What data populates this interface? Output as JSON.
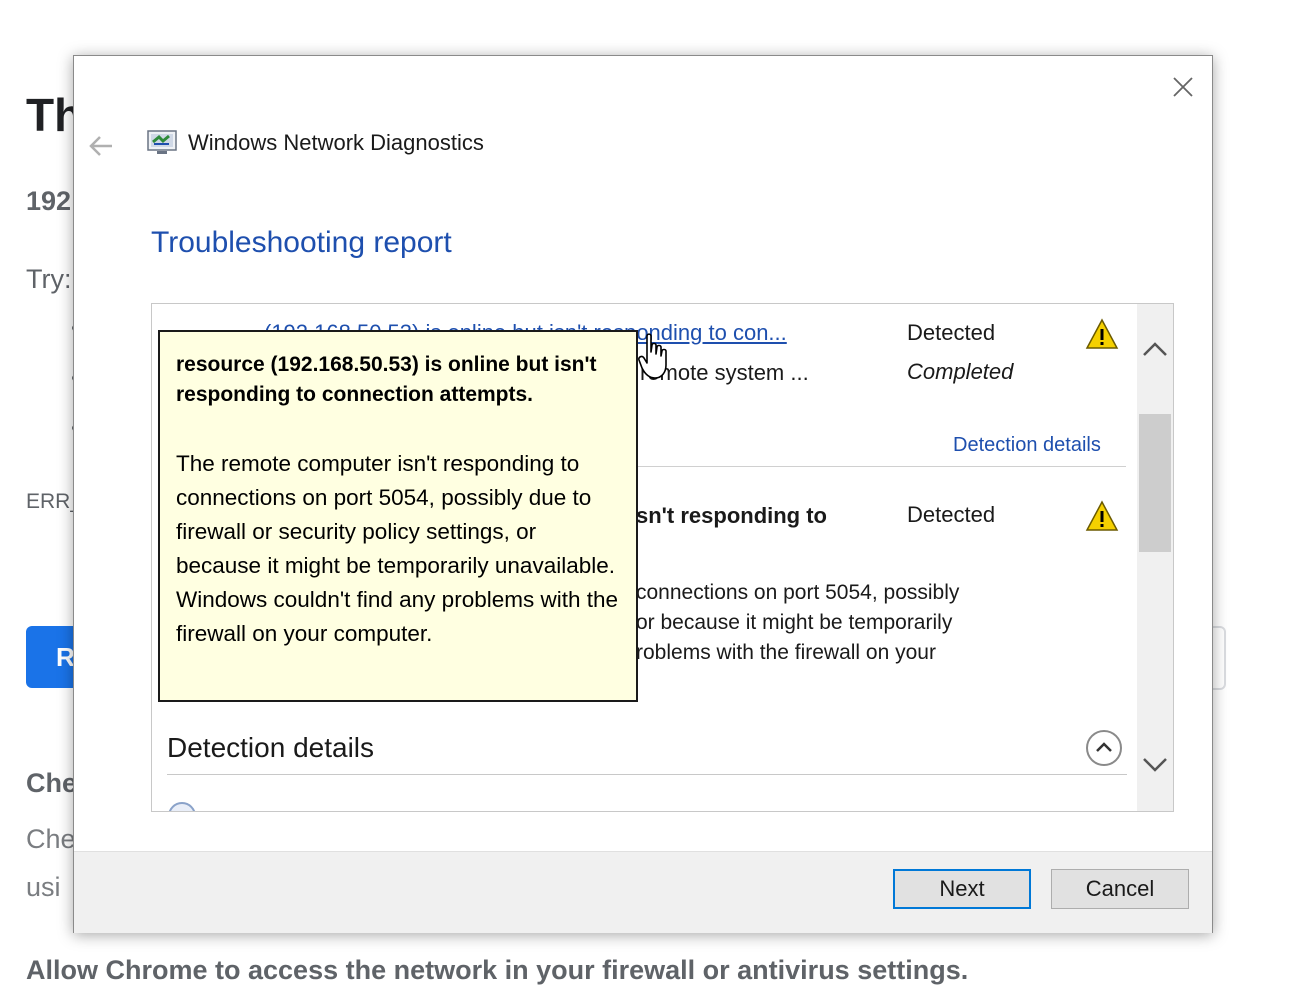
{
  "background_page": {
    "title": "Th",
    "host": "192",
    "try_label": "Try:",
    "error_code": "ERR_",
    "reload_button": "R",
    "check_heading": "Che",
    "check_line1": "Che",
    "check_line2": "usi",
    "allow_heading": "Allow Chrome to access the network in your firewall or antivirus settings."
  },
  "dialog": {
    "title": "Windows Network Diagnostics",
    "heading": "Troubleshooting report",
    "icons": [
      "back-arrow-icon",
      "network-diagnostics-icon",
      "close-icon",
      "warning-icon",
      "chevron-up-icon",
      "chevron-down-icon"
    ],
    "rows": [
      {
        "link": "(192.168.50.53) is online but isn't responding to con...",
        "status": "Detected",
        "sub": "remote system ...",
        "sub_status": "Completed"
      }
    ],
    "detection_details_link": "Detection details",
    "row2": {
      "title": "sn't responding to",
      "status": "Detected",
      "description": [
        " connections on port 5054, possibly",
        "or because it might be temporarily",
        "roblems with the firewall on your"
      ]
    },
    "detection_details_heading": "Detection details",
    "buttons": {
      "next": "Next",
      "cancel": "Cancel"
    }
  },
  "tooltip": {
    "title": "resource (192.168.50.53) is online but isn't responding to connection attempts.",
    "body": "The remote computer isn't responding to connections on port 5054, possibly due to firewall or security policy settings, or because it might be temporarily unavailable. Windows couldn't find any problems with the firewall on your computer."
  },
  "colors": {
    "link_blue": "#1e4fae",
    "tooltip_bg": "#ffffe1",
    "warning_yellow": "#f5d000",
    "chrome_blue": "#1a73e8"
  }
}
